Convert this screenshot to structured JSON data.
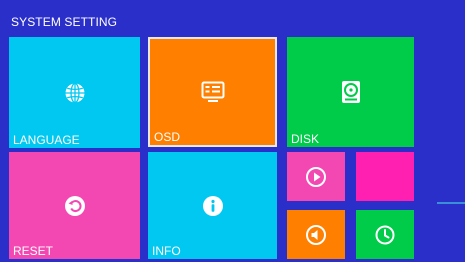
{
  "title": "SYSTEM SETTING",
  "colors": {
    "background": "#2b2fc9",
    "language": "#00c8f0",
    "osd": "#ff7f00",
    "disk": "#00cc4a",
    "reset": "#f347b2",
    "info": "#00c8f0",
    "play": "#f347b2",
    "blank": "#ff1fb0",
    "volume": "#ff7f00",
    "clock": "#00cc4a",
    "osd_border": "#e8e8e8"
  },
  "tiles": {
    "language": {
      "label": "LANGUAGE",
      "icon": "globe-icon"
    },
    "osd": {
      "label": "OSD",
      "icon": "display-icon"
    },
    "disk": {
      "label": "DISK",
      "icon": "hard-disk-icon"
    },
    "reset": {
      "label": "RESET",
      "icon": "reset-icon"
    },
    "info": {
      "label": "INFO",
      "icon": "info-icon"
    },
    "play": {
      "label": "",
      "icon": "play-icon"
    },
    "blank": {
      "label": "",
      "icon": ""
    },
    "volume": {
      "label": "",
      "icon": "volume-icon"
    },
    "clock": {
      "label": "",
      "icon": "clock-icon"
    }
  }
}
